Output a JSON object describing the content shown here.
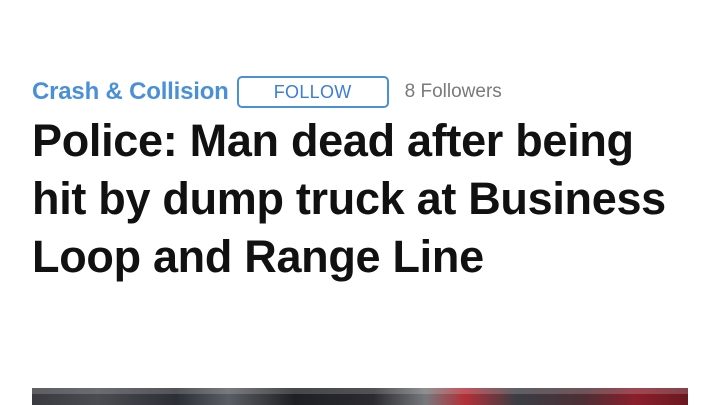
{
  "topic": {
    "name": "Crash & Collision",
    "follow_label": "FOLLOW",
    "followers": "8 Followers"
  },
  "article": {
    "headline": "Police: Man dead after being hit by dump truck at Business Loop and Range Line"
  },
  "colors": {
    "accent": "#4a90d9",
    "headline": "#111111",
    "muted": "#7a7a7a"
  }
}
